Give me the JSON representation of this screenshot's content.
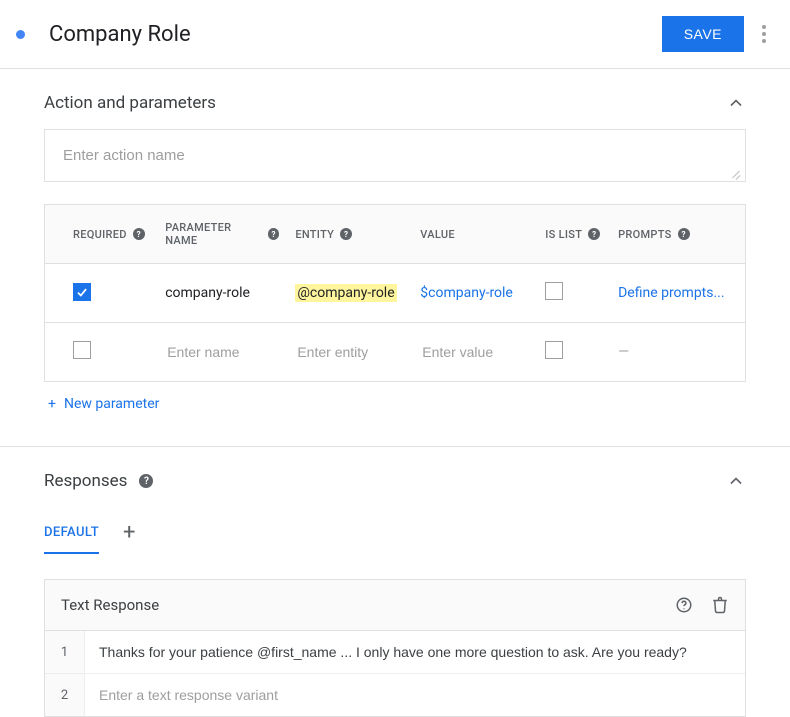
{
  "header": {
    "title": "Company Role",
    "save_label": "SAVE"
  },
  "action_params": {
    "section_title": "Action and parameters",
    "action_name_placeholder": "Enter action name",
    "columns": {
      "required": "REQUIRED",
      "parameter_name": "PARAMETER NAME",
      "entity": "ENTITY",
      "value": "VALUE",
      "is_list": "IS LIST",
      "prompts": "PROMPTS"
    },
    "rows": [
      {
        "required": true,
        "name": "company-role",
        "entity": "@company-role",
        "value": "$company-role",
        "is_list": false,
        "prompts_label": "Define prompts..."
      }
    ],
    "blank_row": {
      "name_placeholder": "Enter name",
      "entity_placeholder": "Enter entity",
      "value_placeholder": "Enter value",
      "prompts_label": "—"
    },
    "new_parameter_label": "New parameter"
  },
  "responses": {
    "section_title": "Responses",
    "tabs": {
      "default": "DEFAULT"
    },
    "text_response": {
      "title": "Text Response",
      "rows": [
        {
          "num": "1",
          "text": "Thanks for your patience @first_name ... I only have one more question to ask. Are you ready?"
        },
        {
          "num": "2",
          "placeholder": "Enter a text response variant"
        }
      ]
    }
  }
}
